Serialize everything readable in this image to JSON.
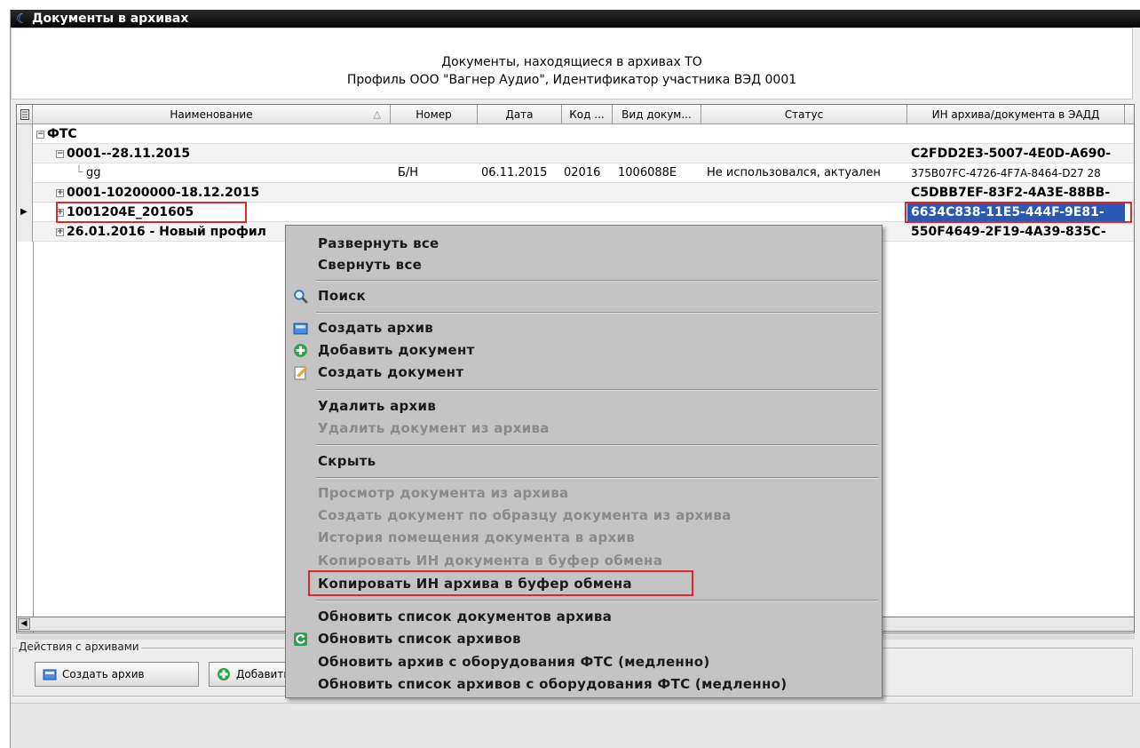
{
  "window": {
    "title": "Документы в архивах"
  },
  "header": {
    "line1": "Документы, находящиеся в архивах ТО",
    "line2": "Профиль ООО \"Вагнер Аудио\", Идентификатор участника ВЭД 0001"
  },
  "grid": {
    "columns": [
      "Наименование",
      "Номер",
      "Дата",
      "Код ...",
      "Вид докум...",
      "Статус",
      "ИН архива/документа в ЭАДД"
    ],
    "rows": [
      {
        "name": "ФТС",
        "number": "",
        "date": "",
        "code": "",
        "doc_type": "",
        "status": "",
        "id": ""
      },
      {
        "name": "0001--28.11.2015",
        "number": "",
        "date": "",
        "code": "",
        "doc_type": "",
        "status": "",
        "id": "C2FDD2E3-5007-4E0D-A690-"
      },
      {
        "name": "gg",
        "number": "Б/Н",
        "date": "06.11.2015",
        "code": "02016",
        "doc_type": "1006088E",
        "status": "Не использовался, актуален",
        "id": "375B07FC-4726-4F7A-8464-D27 28"
      },
      {
        "name": "0001-10200000-18.12.2015",
        "number": "",
        "date": "",
        "code": "",
        "doc_type": "",
        "status": "",
        "id": "C5DBB7EF-83F2-4A3E-88BB-"
      },
      {
        "name": "1001204E_201605",
        "number": "",
        "date": "",
        "code": "",
        "doc_type": "",
        "status": "",
        "id": "6634C838-11E5-444F-9E81-"
      },
      {
        "name": "26.01.2016 - Новый профил",
        "number": "",
        "date": "",
        "code": "",
        "doc_type": "",
        "status": "",
        "id": "550F4649-2F19-4A39-835C-"
      }
    ]
  },
  "actions": {
    "group_label": "Действия с архивами",
    "create_archive": "Создать архив",
    "add_document": "Добавить"
  },
  "context_menu": {
    "items": [
      {
        "label": "Развернуть все",
        "enabled": true
      },
      {
        "label": "Свернуть все",
        "enabled": true
      },
      {
        "label": "Поиск",
        "enabled": true,
        "icon": "search-icon"
      },
      {
        "label": "Создать архив",
        "enabled": true,
        "icon": "archive-icon"
      },
      {
        "label": "Добавить документ",
        "enabled": true,
        "icon": "add-icon"
      },
      {
        "label": "Создать документ",
        "enabled": true,
        "icon": "edit-document-icon"
      },
      {
        "label": "Удалить архив",
        "enabled": true
      },
      {
        "label": "Удалить документ из архива",
        "enabled": false
      },
      {
        "label": "Скрыть",
        "enabled": true
      },
      {
        "label": "Просмотр документа из архива",
        "enabled": false
      },
      {
        "label": "Создать документ по образцу документа из архива",
        "enabled": false
      },
      {
        "label": "История помещения документа в архив",
        "enabled": false
      },
      {
        "label": "Копировать ИН документа в буфер обмена",
        "enabled": false
      },
      {
        "label": "Копировать ИН архива в буфер обмена",
        "enabled": true
      },
      {
        "label": "Обновить список документов архива",
        "enabled": true
      },
      {
        "label": "Обновить список архивов",
        "enabled": true,
        "icon": "refresh-icon"
      },
      {
        "label": "Обновить архив с оборудования ФТС (медленно)",
        "enabled": true
      },
      {
        "label": "Обновить список архивов с оборудования ФТС (медленно)",
        "enabled": true
      }
    ]
  },
  "colors": {
    "selection": "#2a59b5",
    "highlight_box": "#e0262b",
    "menu_bg": "#c4c4c4",
    "title_bg": "#0a0a0a"
  }
}
